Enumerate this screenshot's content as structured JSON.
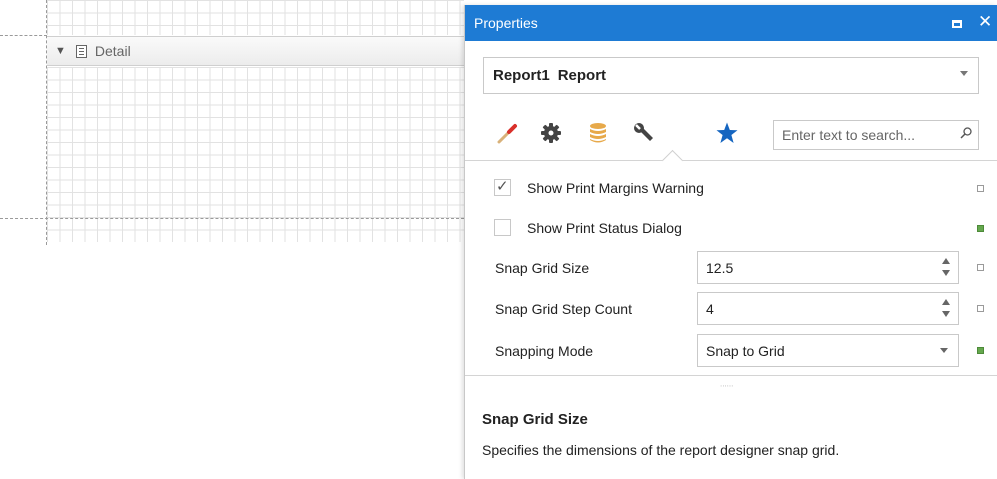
{
  "designer": {
    "band_label": "Detail"
  },
  "panel": {
    "title": "Properties",
    "selector": {
      "name": "Report1",
      "type": "Report"
    },
    "toolbar": {
      "tabs": [
        "appearance-brush",
        "behavior-gear",
        "data-database",
        "design-wrench",
        "favorites-star"
      ],
      "active_tab": "design-wrench"
    },
    "search": {
      "placeholder": "Enter text to search..."
    },
    "properties": {
      "show_print_margins_warning": {
        "label": "Show Print Margins Warning",
        "checked": true
      },
      "show_print_status_dialog": {
        "label": "Show Print Status Dialog",
        "checked": false
      },
      "snap_grid_size": {
        "label": "Snap Grid Size",
        "value": "12.5"
      },
      "snap_grid_step_count": {
        "label": "Snap Grid Step Count",
        "value": "4"
      },
      "snapping_mode": {
        "label": "Snapping Mode",
        "value": "Snap to Grid"
      }
    },
    "description": {
      "title": "Snap Grid Size",
      "text": "Specifies the dimensions of the report designer snap grid."
    }
  },
  "colors": {
    "titlebar": "#1e7bd4",
    "brush_tip": "#d9302a",
    "database": "#e7a94a",
    "star": "#1565c0",
    "changed_indicator": "#65a84e"
  }
}
